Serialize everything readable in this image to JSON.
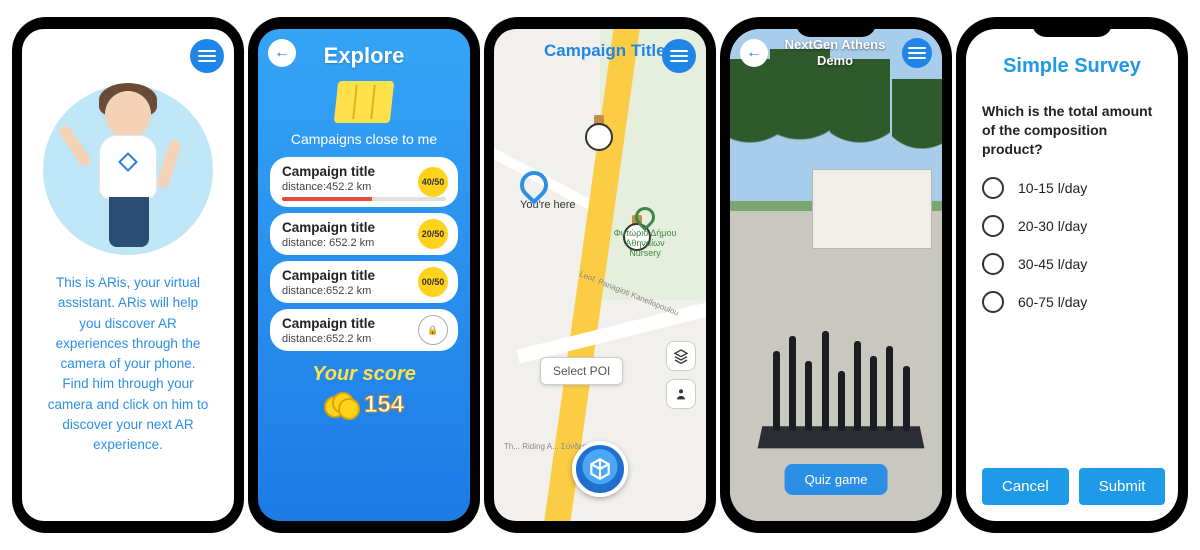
{
  "screen1": {
    "intro": "This is ARis, your virtual assistant. ARis will help you discover AR experiences through the camera of your phone. Find him through your camera and click on him to discover your next AR experience."
  },
  "screen2": {
    "title": "Explore",
    "subhead": "Campaigns close to me",
    "campaigns": [
      {
        "title": "Campaign title",
        "distance": "distance:452.2 km",
        "badge": "40/50",
        "progress": true
      },
      {
        "title": "Campaign title",
        "distance": "distance: 652.2 km",
        "badge": "20/50"
      },
      {
        "title": "Campaign title",
        "distance": "distance:652.2 km",
        "badge": "00/50"
      },
      {
        "title": "Campaign title",
        "distance": "distance:652.2 km",
        "locked": true
      }
    ],
    "score_label": "Your score",
    "score_value": "154"
  },
  "screen3": {
    "title": "Campaign Title",
    "here_label": "You're here",
    "poi_button": "Select POI",
    "poi_name": "Φυτώριο Δήμου Αθηναίων Nursery",
    "road_label": "Leof. Panagioti Kanellopoulou",
    "bottom_text": "Th... Riding A... Σύνδεσμος..."
  },
  "screen4": {
    "title_line1": "NextGen Athens",
    "title_line2": "Demo",
    "quiz": "Quiz game"
  },
  "screen5": {
    "title": "Simple Survey",
    "question": "Which is the total amount of the composition product?",
    "opts": [
      "10-15 l/day",
      "20-30 l/day",
      "30-45 l/day",
      "60-75 l/day"
    ],
    "cancel": "Cancel",
    "submit": "Submit"
  }
}
